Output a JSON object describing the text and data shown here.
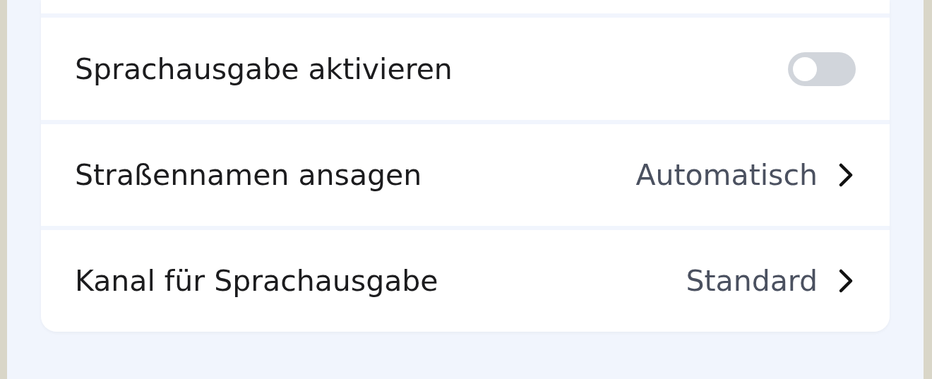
{
  "settings": [
    {
      "kind": "toggle",
      "label": "Sprachausgabe aktivieren",
      "on": false
    },
    {
      "kind": "choice",
      "label": "Straßennamen ansagen",
      "value": "Automatisch"
    },
    {
      "kind": "choice",
      "label": "Kanal für Sprachausgabe",
      "value": "Standard"
    }
  ]
}
